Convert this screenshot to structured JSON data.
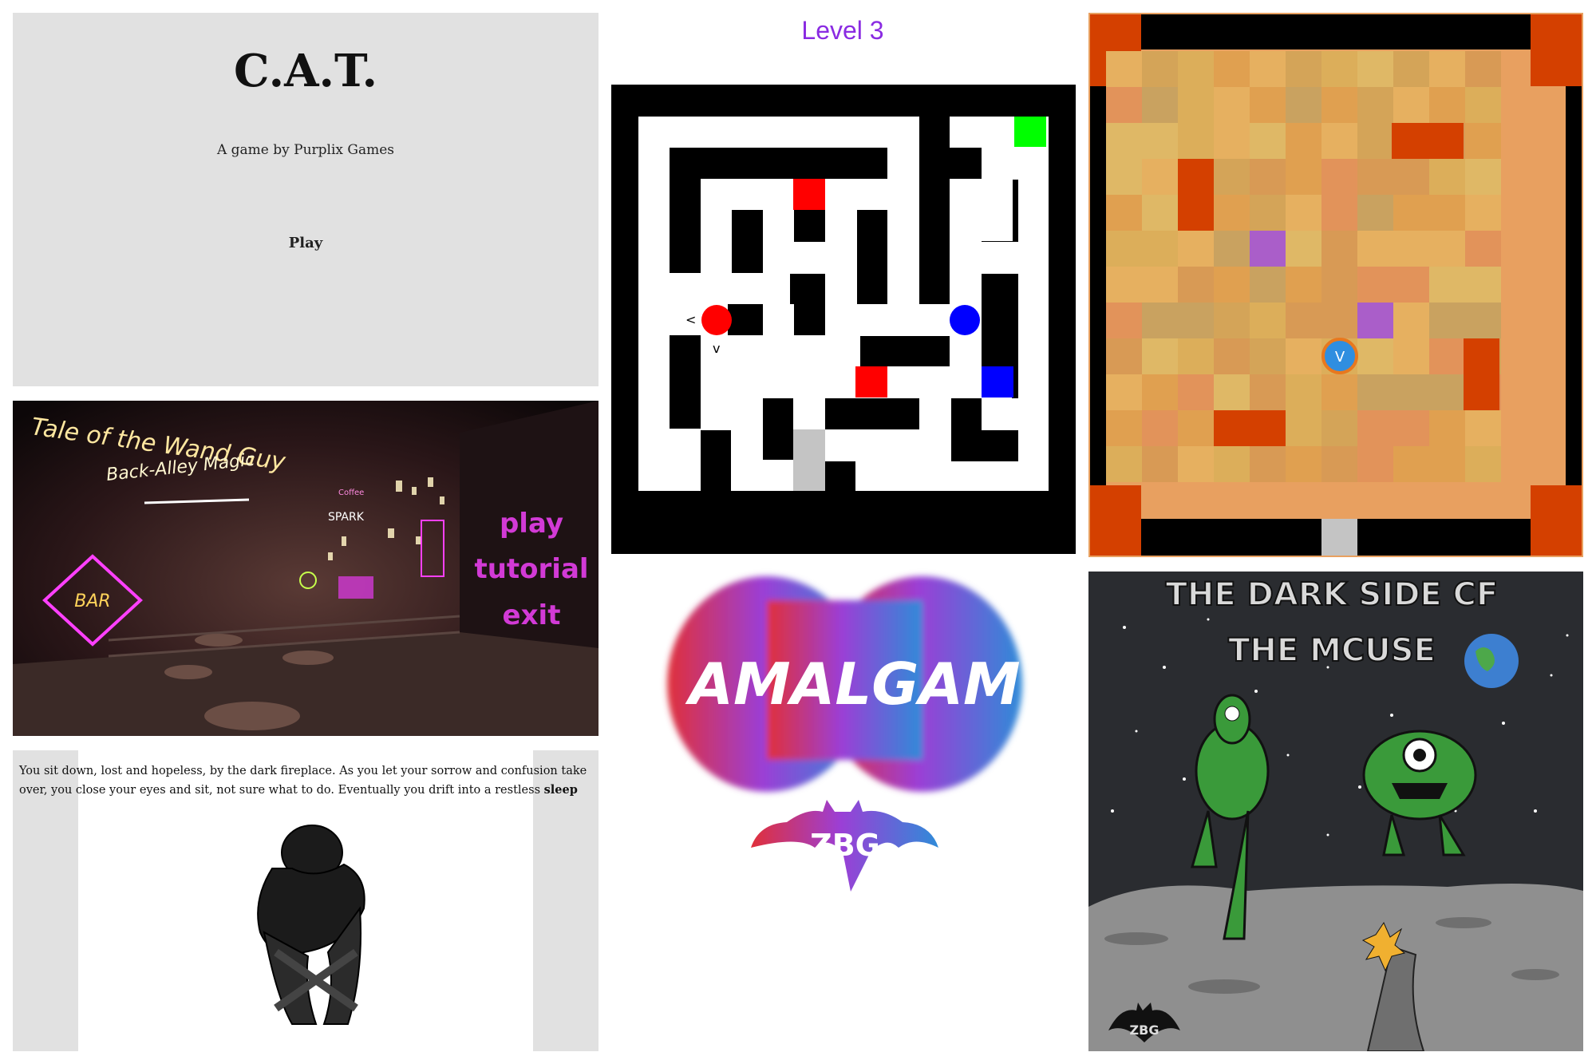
{
  "colors": {
    "cat_bg": "#e1e1e1",
    "level_label": "#8a2be2",
    "maze_wall": "#000000",
    "maze_goal": "#00ff00",
    "maze_red": "#ff0000",
    "maze_blue": "#0000ff",
    "maze_exit": "#c4c4c4",
    "grid_hot": "#d44000",
    "grid_purple": "#aa5ec9",
    "player_blue": "#2f8ee0",
    "neon_pink": "#d23ad6",
    "neon_yellow": "#ffe7a0"
  },
  "cat": {
    "title": "C.A.T.",
    "subtitle": "A game by Purplix Games",
    "play": "Play"
  },
  "maze": {
    "level": "Level 3",
    "arrow_left": "<",
    "arrow_right": ">",
    "arrow_down": "v"
  },
  "grid_game": {
    "player_glyph": "V"
  },
  "tale": {
    "title": "Tale of the Wand Guy",
    "subtitle": "Back-Alley Magic",
    "menu": [
      "play",
      "tutorial",
      "exit"
    ],
    "sign_bar": "BAR",
    "sign_spark": "SPARK",
    "sign_coffee": "Coffee"
  },
  "amalgam": {
    "logo_text": "AMALGAM",
    "badge_text": "ZBG"
  },
  "dark_side": {
    "title_line1": "THE DARK SIDE CF",
    "title_line2": "THE MCUSE",
    "corner_logo": "ZBG"
  },
  "story": {
    "text": "You sit down, lost and hopeless, by the dark fireplace. As you let your sorrow and confusion take over, you close your eyes and sit, not sure what to do. Eventually you drift into a restless",
    "bold_word": "sleep"
  }
}
